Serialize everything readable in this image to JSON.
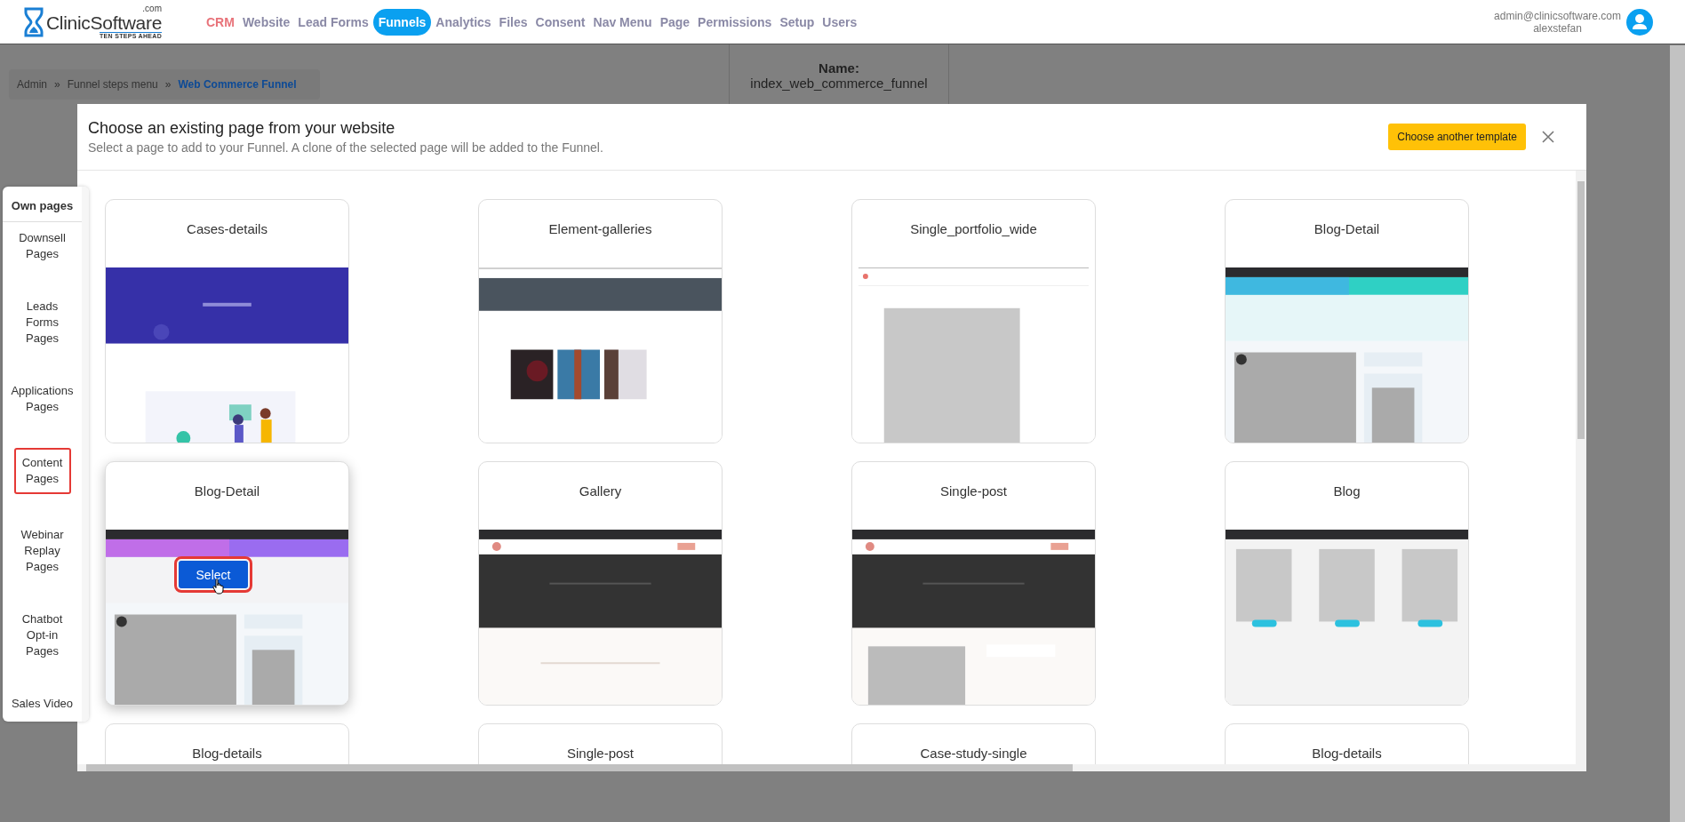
{
  "header": {
    "logo": {
      "name": "ClinicSoftware",
      "domain": ".com",
      "tagline": "TEN STEPS AHEAD"
    },
    "nav": [
      {
        "label": "CRM",
        "selected": false,
        "highlighted": true
      },
      {
        "label": "Website",
        "selected": false,
        "highlighted": false
      },
      {
        "label": "Lead Forms",
        "selected": false,
        "highlighted": false
      },
      {
        "label": "Funnels",
        "selected": true,
        "highlighted": false
      },
      {
        "label": "Analytics",
        "selected": false,
        "highlighted": false
      },
      {
        "label": "Files",
        "selected": false,
        "highlighted": false
      },
      {
        "label": "Consent",
        "selected": false,
        "highlighted": false
      },
      {
        "label": "Nav Menu",
        "selected": false,
        "highlighted": false
      },
      {
        "label": "Page",
        "selected": false,
        "highlighted": false
      },
      {
        "label": "Permissions",
        "selected": false,
        "highlighted": false
      },
      {
        "label": "Setup",
        "selected": false,
        "highlighted": false
      },
      {
        "label": "Users",
        "selected": false,
        "highlighted": false
      }
    ],
    "user": {
      "email": "admin@clinicsoftware.com",
      "username": "alexstefan"
    }
  },
  "breadcrumb": [
    {
      "label": "Admin",
      "current": false
    },
    {
      "label": "»",
      "current": false
    },
    {
      "label": "Funnel steps menu",
      "current": false
    },
    {
      "label": "»",
      "current": false
    },
    {
      "label": "Web Commerce Funnel",
      "current": true
    }
  ],
  "name_panel": {
    "label": "Name:",
    "value": "index_web_commerce_funnel"
  },
  "modal": {
    "title": "Choose an existing page from your website",
    "subtitle": "Select a page to add to your Funnel. A clone of the selected page will be added to the Funnel.",
    "action_button": "Choose another template",
    "cards": [
      {
        "title": "Cases-details"
      },
      {
        "title": "Element-galleries"
      },
      {
        "title": "Single_portfolio_wide"
      },
      {
        "title": "Blog-Detail"
      },
      {
        "title": "Blog-Detail",
        "select_button": {
          "label": "Select",
          "highlighted": true
        }
      },
      {
        "title": "Gallery"
      },
      {
        "title": "Single-post"
      },
      {
        "title": "Blog"
      },
      {
        "title": "Blog-details"
      },
      {
        "title": "Single-post"
      },
      {
        "title": "Case-study-single"
      },
      {
        "title": "Blog-details"
      }
    ]
  },
  "sidebar": {
    "heading": "Own pages",
    "items": [
      {
        "label": "Downsell Pages",
        "selected": false
      },
      {
        "label": "Leads Forms Pages",
        "selected": false
      },
      {
        "label": "Applications Pages",
        "selected": false
      },
      {
        "label": "Content Pages",
        "selected": true
      },
      {
        "label": "Webinar Replay Pages",
        "selected": false
      },
      {
        "label": "Chatbot Opt-in Pages",
        "selected": false
      },
      {
        "label": "Sales Video",
        "selected": false
      }
    ]
  }
}
